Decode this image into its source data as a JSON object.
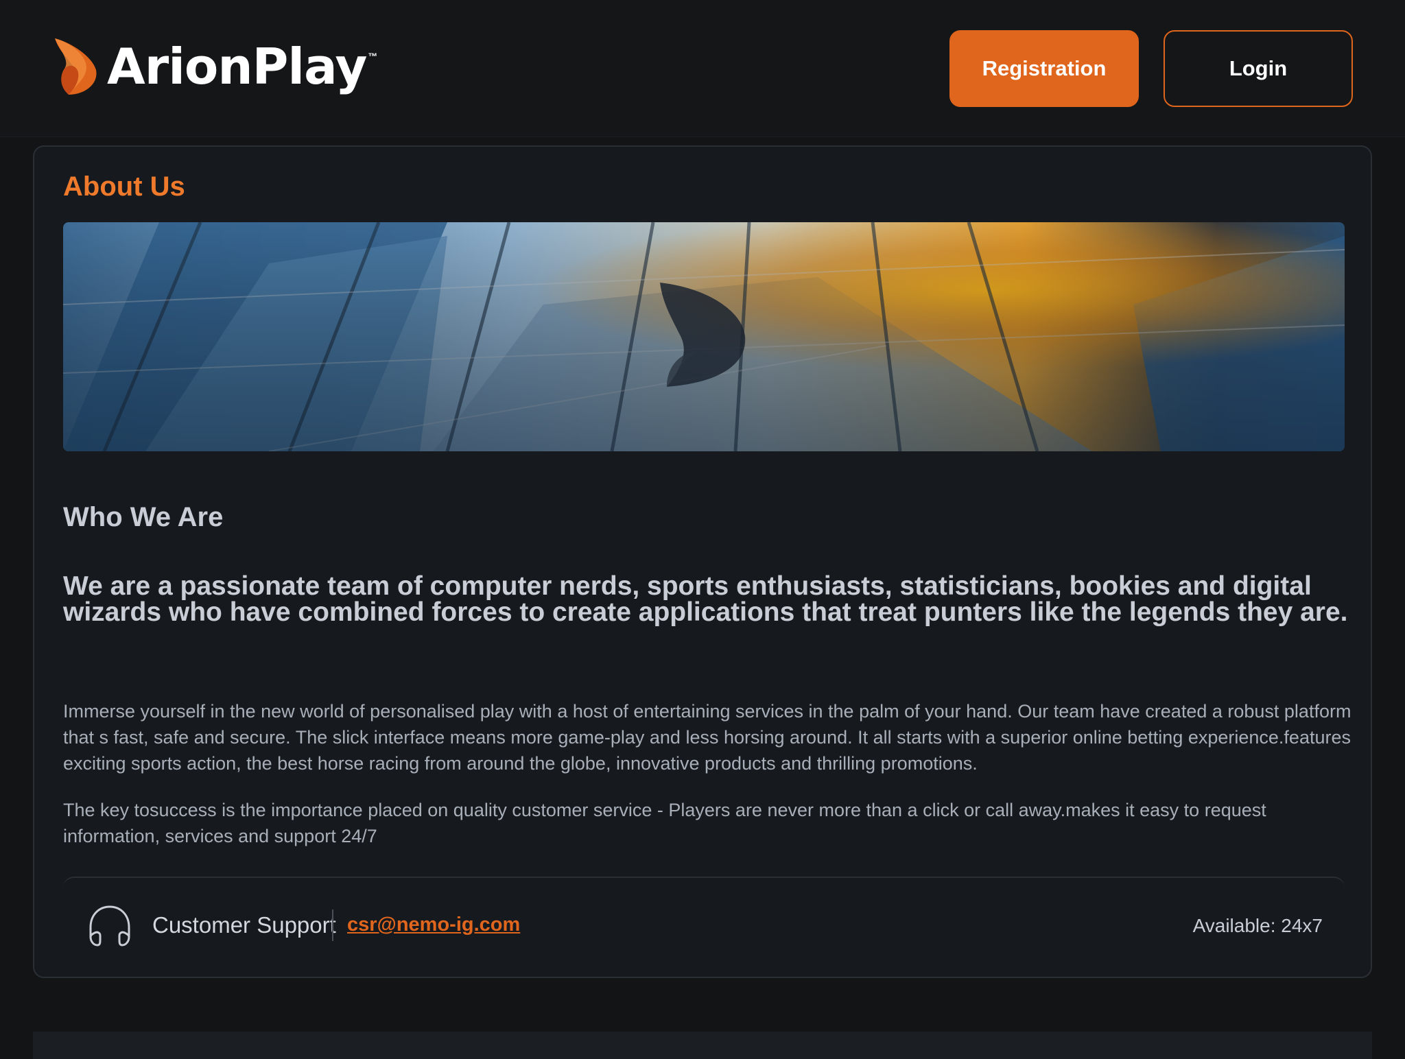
{
  "header": {
    "logo_text": "ArionPlay",
    "logo_tm": "™",
    "registration_label": "Registration",
    "login_label": "Login"
  },
  "colors": {
    "accent": "#e0651d",
    "heading_accent": "#f07a2c",
    "background": "#121416",
    "card": "#161a1f"
  },
  "about": {
    "title": "About Us",
    "banner_icon": "arionplay-logo-icon",
    "who_title": "Who We Are",
    "lead": "We are a passionate team of computer nerds, sports enthusiasts, statisticians, bookies and digital wizards who have combined forces to create applications that treat punters like the legends they are.",
    "paragraph_1": "Immerse yourself in the new world of personalised play with a host of entertaining services in the palm of your hand. Our team have created a robust platform that s fast, safe and secure. The slick interface means more game-play and less horsing around. It all starts with a superior online betting experience.features exciting sports action, the best horse racing from around the globe, innovative products and thrilling promotions.",
    "paragraph_2": "The key tosuccess is the importance placed on quality customer service - Players are never more than a click or call away.makes it easy to request information, services and support 24/7"
  },
  "support": {
    "icon": "headset-icon",
    "label": "Customer Support",
    "email": "csr@nemo-ig.com",
    "availability": "Available: 24x7"
  }
}
